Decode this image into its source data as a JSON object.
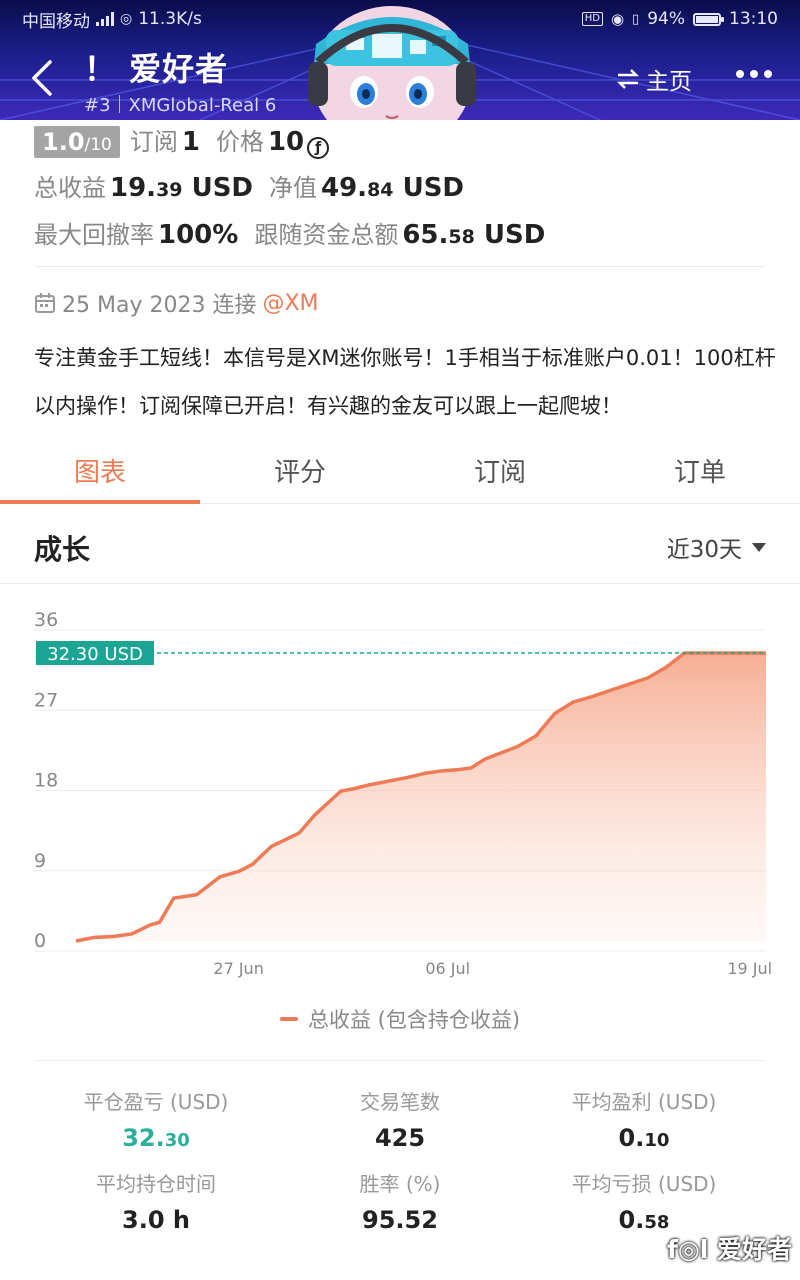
{
  "status_bar": {
    "carrier": "中国移动",
    "speed": "11.3K/s",
    "battery": "94%",
    "time": "13:10"
  },
  "header": {
    "title": "！ 爱好者",
    "subtitle": "#3｜XMGlobal-Real 6",
    "home_label": "主页"
  },
  "summary": {
    "rating": "1.0",
    "rating_max": "/10",
    "subscribe_label": "订阅",
    "subscribe_value": "1",
    "price_label": "价格",
    "price_value": "10",
    "price_icon": "ƒ",
    "total_profit_label": "总收益",
    "total_profit_int": "19.",
    "total_profit_dec": "39",
    "total_profit_unit": "USD",
    "equity_label": "净值",
    "equity_int": "49.",
    "equity_dec": "84",
    "equity_unit": "USD",
    "drawdown_label": "最大回撤率",
    "drawdown_value": "100%",
    "follow_label": "跟随资金总额",
    "follow_int": "65.",
    "follow_dec": "58",
    "follow_unit": "USD"
  },
  "info": {
    "date_text": "25 May 2023 连接",
    "broker": "@XM",
    "description": "专注黄金手工短线！本信号是XM迷你账号！1手相当于标准账户0.01！100杠杆以内操作！订阅保障已开启！有兴趣的金友可以跟上一起爬坡！"
  },
  "tabs": [
    {
      "label": "图表",
      "active": true
    },
    {
      "label": "评分",
      "active": false
    },
    {
      "label": "订阅",
      "active": false
    },
    {
      "label": "订单",
      "active": false
    }
  ],
  "section": {
    "title": "成长",
    "range": "近30天"
  },
  "chart_data": {
    "type": "area",
    "y_ticks": [
      "36",
      "27",
      "18",
      "9",
      "0"
    ],
    "ylim": [
      0,
      36
    ],
    "x_ticks": [
      {
        "label": "27 Jun",
        "x": 7
      },
      {
        "label": "06 Jul",
        "x": 16
      },
      {
        "label": "19 Jul",
        "x": 29
      }
    ],
    "x_range": [
      0,
      29.7
    ],
    "current_label": "32.30 USD",
    "current_value": 32.3,
    "legend": "总收益 (包含持仓收益)",
    "color": "#ee7b55",
    "marker_color": "#1aa595",
    "x": [
      0,
      0.8,
      1.6,
      2.4,
      3.2,
      3.6,
      4.2,
      5.2,
      6.2,
      7.0,
      7.6,
      8.4,
      9.6,
      10.3,
      11.4,
      12.0,
      12.6,
      13.4,
      14.2,
      15.0,
      15.8,
      16.4,
      17.0,
      17.6,
      18.2,
      19.0,
      19.8,
      20.6,
      21.4,
      22.2,
      23.0,
      23.8,
      24.6,
      25.4,
      26.2,
      26.8,
      27.4,
      28.4,
      29.7
    ],
    "values": [
      0,
      0.4,
      0.5,
      0.8,
      1.8,
      2.1,
      4.8,
      5.2,
      7.2,
      7.8,
      8.6,
      10.6,
      12.1,
      14.2,
      16.8,
      17.1,
      17.5,
      17.9,
      18.3,
      18.8,
      19.1,
      19.2,
      19.4,
      20.4,
      21.0,
      21.8,
      23.0,
      25.5,
      26.8,
      27.4,
      28.1,
      28.8,
      29.5,
      30.7,
      32.3,
      32.3,
      32.3,
      32.3,
      32.3
    ]
  },
  "metrics": [
    {
      "label": "平仓盈亏 (USD)",
      "int": "32.",
      "dec": "30",
      "green": true
    },
    {
      "label": "交易笔数",
      "int": "425",
      "dec": "",
      "green": false
    },
    {
      "label": "平均盈利 (USD)",
      "int": "0.",
      "dec": "10",
      "green": false
    },
    {
      "label": "平均持仓时间",
      "int": "3.0 h",
      "dec": "",
      "green": false
    },
    {
      "label": "胜率 (%)",
      "int": "95.52",
      "dec": "",
      "green": false
    },
    {
      "label": "平均亏损 (USD)",
      "int": "0.",
      "dec": "58",
      "green": false
    }
  ],
  "watermark": "爱好者"
}
